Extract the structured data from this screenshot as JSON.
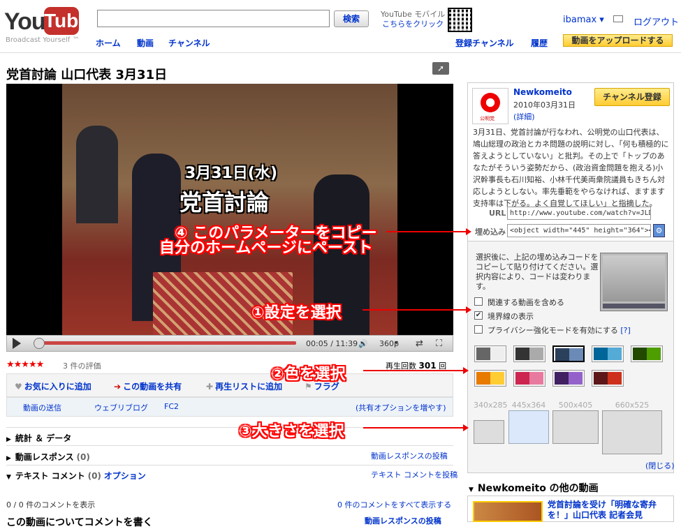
{
  "header": {
    "logo_you": "You",
    "logo_tube": "Tube",
    "tagline": "Broadcast Yourself ™",
    "search_button": "検索",
    "search_value": "",
    "mobile_line1": "YouTube モバイル",
    "mobile_line2": "こちらをクリック",
    "user": "ibamax ▾",
    "logout": "ログアウト",
    "nav": [
      "ホーム",
      "動画",
      "チャンネル"
    ],
    "nav_right": [
      "登録チャンネル",
      "履歴"
    ],
    "upload_button": "動画をアップロードする"
  },
  "video": {
    "title": "党首討論 山口代表 3月31日",
    "overlay_date": "3月31日(水)",
    "overlay_heading": "党首討論",
    "time": "00:05 / 11:39",
    "quality": "360p",
    "progress_fraction": 0.01,
    "stars": "★★★★★",
    "rating_text": "3 件の評価",
    "views_label": "再生回数",
    "views_count": "301",
    "views_unit": "回"
  },
  "actions": {
    "favorite": "お気に入りに追加",
    "share": "この動画を共有",
    "playlist": "再生リストに追加",
    "flag": "フラグ"
  },
  "share_links": {
    "send": "動画の送信",
    "blog": "ウェブリブログ",
    "fc2": "FC2",
    "more": "(共有オプションを増やす)"
  },
  "sections": {
    "stats": "統計 ＆ データ",
    "responses": "動画レスポンス",
    "responses_count": "(0)",
    "responses_link": "動画レスポンスの投稿",
    "comments": "テキスト コメント",
    "comments_count": "(0)",
    "comments_option": "オプション",
    "comments_link": "テキスト コメントを投稿",
    "showing": "0 / 0 件のコメントを表示",
    "show_all": "0 件のコメントをすべて表示する",
    "write": "この動画についてコメントを書く",
    "write_link": "動画レスポンスの投稿"
  },
  "channel": {
    "name": "Newkomeito",
    "date": "2010年03月31日",
    "details": "(詳細)",
    "subscribe": "チャンネル登録",
    "avatar_text": "公明党",
    "description": "3月31日、党首討論が行なわれ、公明党の山口代表は、鳩山総理の政治とカネ問題の説明に対し、「何も積極的に答えようとしていない」と批判。その上で「トップのあなたがそういう姿勢だから、(政治資金問題を抱える)小沢幹事長も石川知裕、小林千代美両衆院議員もきちん対応しようとしない。率先垂範をやらなければ、ますます支持率は下がる。よく自覚してほしい」と指摘した。",
    "url_label": "URL",
    "url_value": "http://www.youtube.com/watch?v=JLDe1n1",
    "embed_label": "埋め込み",
    "embed_value": "<object width=\"445\" height=\"364\"><param"
  },
  "embed_options": {
    "note": "選択後に、上記の埋め込みコードをコピーして貼り付けてください。選択内容により、コードは変わります。",
    "related": "関連する動画を含める",
    "border": "境界線の表示",
    "privacy": "プライバシー強化モードを有効にする",
    "privacy_help": "[?]",
    "related_checked": false,
    "border_checked": true,
    "privacy_checked": false,
    "colors": [
      [
        "#666666",
        "#eeeeee"
      ],
      [
        "#333333",
        "#aaaaaa"
      ],
      [
        "#2b405b",
        "#6b8ab6"
      ],
      [
        "#006699",
        "#54abd6"
      ],
      [
        "#234900",
        "#4e9e00"
      ],
      [
        "#e87a00",
        "#ffcc33"
      ],
      [
        "#cc2550",
        "#e87a9f"
      ],
      [
        "#402061",
        "#9461ca"
      ],
      [
        "#5d1719",
        "#cd311b"
      ]
    ],
    "sizes": [
      "340x285",
      "445x364",
      "500x405",
      "660x525"
    ],
    "close": "(閉じる)"
  },
  "other_videos": {
    "heading": "Newkomeito の他の動画",
    "first_title": "党首討論を受け「明確な寄弁を！」山口代表 記者会見"
  },
  "annotations": {
    "a4_line1": "④ このパラメーターをコピー",
    "a4_line2": "自分のホームページにペースト",
    "a1": "①設定を選択",
    "a2": "②色を選択",
    "a3": "③大きさを選択"
  }
}
